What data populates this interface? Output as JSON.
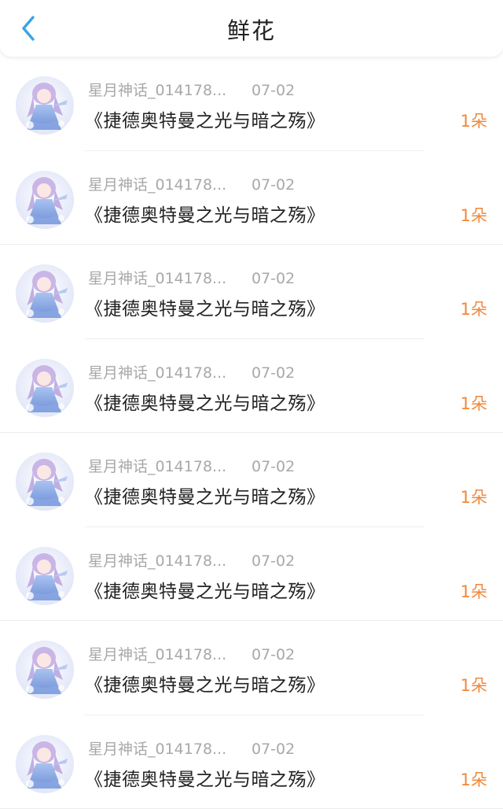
{
  "header": {
    "title": "鲜花"
  },
  "colors": {
    "accent_blue": "#3ba3e6",
    "quantity_orange": "#f0883c"
  },
  "items": [
    {
      "user": "星月神话_014178...",
      "date": "07-02",
      "book": "《捷德奥特曼之光与暗之殇》",
      "quantity": "1朵"
    },
    {
      "user": "星月神话_014178...",
      "date": "07-02",
      "book": "《捷德奥特曼之光与暗之殇》",
      "quantity": "1朵"
    },
    {
      "user": "星月神话_014178...",
      "date": "07-02",
      "book": "《捷德奥特曼之光与暗之殇》",
      "quantity": "1朵"
    },
    {
      "user": "星月神话_014178...",
      "date": "07-02",
      "book": "《捷德奥特曼之光与暗之殇》",
      "quantity": "1朵"
    },
    {
      "user": "星月神话_014178...",
      "date": "07-02",
      "book": "《捷德奥特曼之光与暗之殇》",
      "quantity": "1朵"
    },
    {
      "user": "星月神话_014178...",
      "date": "07-02",
      "book": "《捷德奥特曼之光与暗之殇》",
      "quantity": "1朵"
    },
    {
      "user": "星月神话_014178...",
      "date": "07-02",
      "book": "《捷德奥特曼之光与暗之殇》",
      "quantity": "1朵"
    },
    {
      "user": "星月神话_014178...",
      "date": "07-02",
      "book": "《捷德奥特曼之光与暗之殇》",
      "quantity": "1朵"
    }
  ]
}
